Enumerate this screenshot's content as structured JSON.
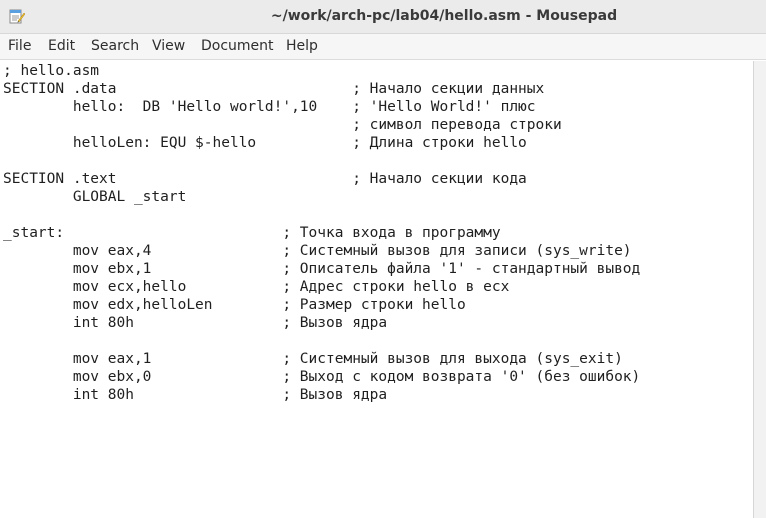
{
  "window": {
    "title": "~/work/arch-pc/lab04/hello.asm - Mousepad",
    "app_icon": "mousepad-notepad-icon"
  },
  "menu": {
    "items": [
      "File",
      "Edit",
      "Search",
      "View",
      "Document",
      "Help"
    ]
  },
  "editor": {
    "lines": [
      "; hello.asm",
      "SECTION .data                           ; Начало секции данных",
      "        hello:  DB 'Hello world!',10    ; 'Hello World!' плюс",
      "                                        ; символ перевода строки",
      "        helloLen: EQU $-hello           ; Длина строки hello",
      "",
      "SECTION .text                           ; Начало секции кода",
      "        GLOBAL _start",
      "",
      "_start:                         ; Точка входа в программу",
      "        mov eax,4               ; Системный вызов для записи (sys_write)",
      "        mov ebx,1               ; Описатель файла '1' - стандартный вывод",
      "        mov ecx,hello           ; Адрес строки hello в ecx",
      "        mov edx,helloLen        ; Размер строки hello",
      "        int 80h                 ; Вызов ядра",
      "",
      "        mov eax,1               ; Системный вызов для выхода (sys_exit)",
      "        mov ebx,0               ; Выход с кодом возврата '0' (без ошибок)",
      "        int 80h                 ; Вызов ядра"
    ]
  }
}
